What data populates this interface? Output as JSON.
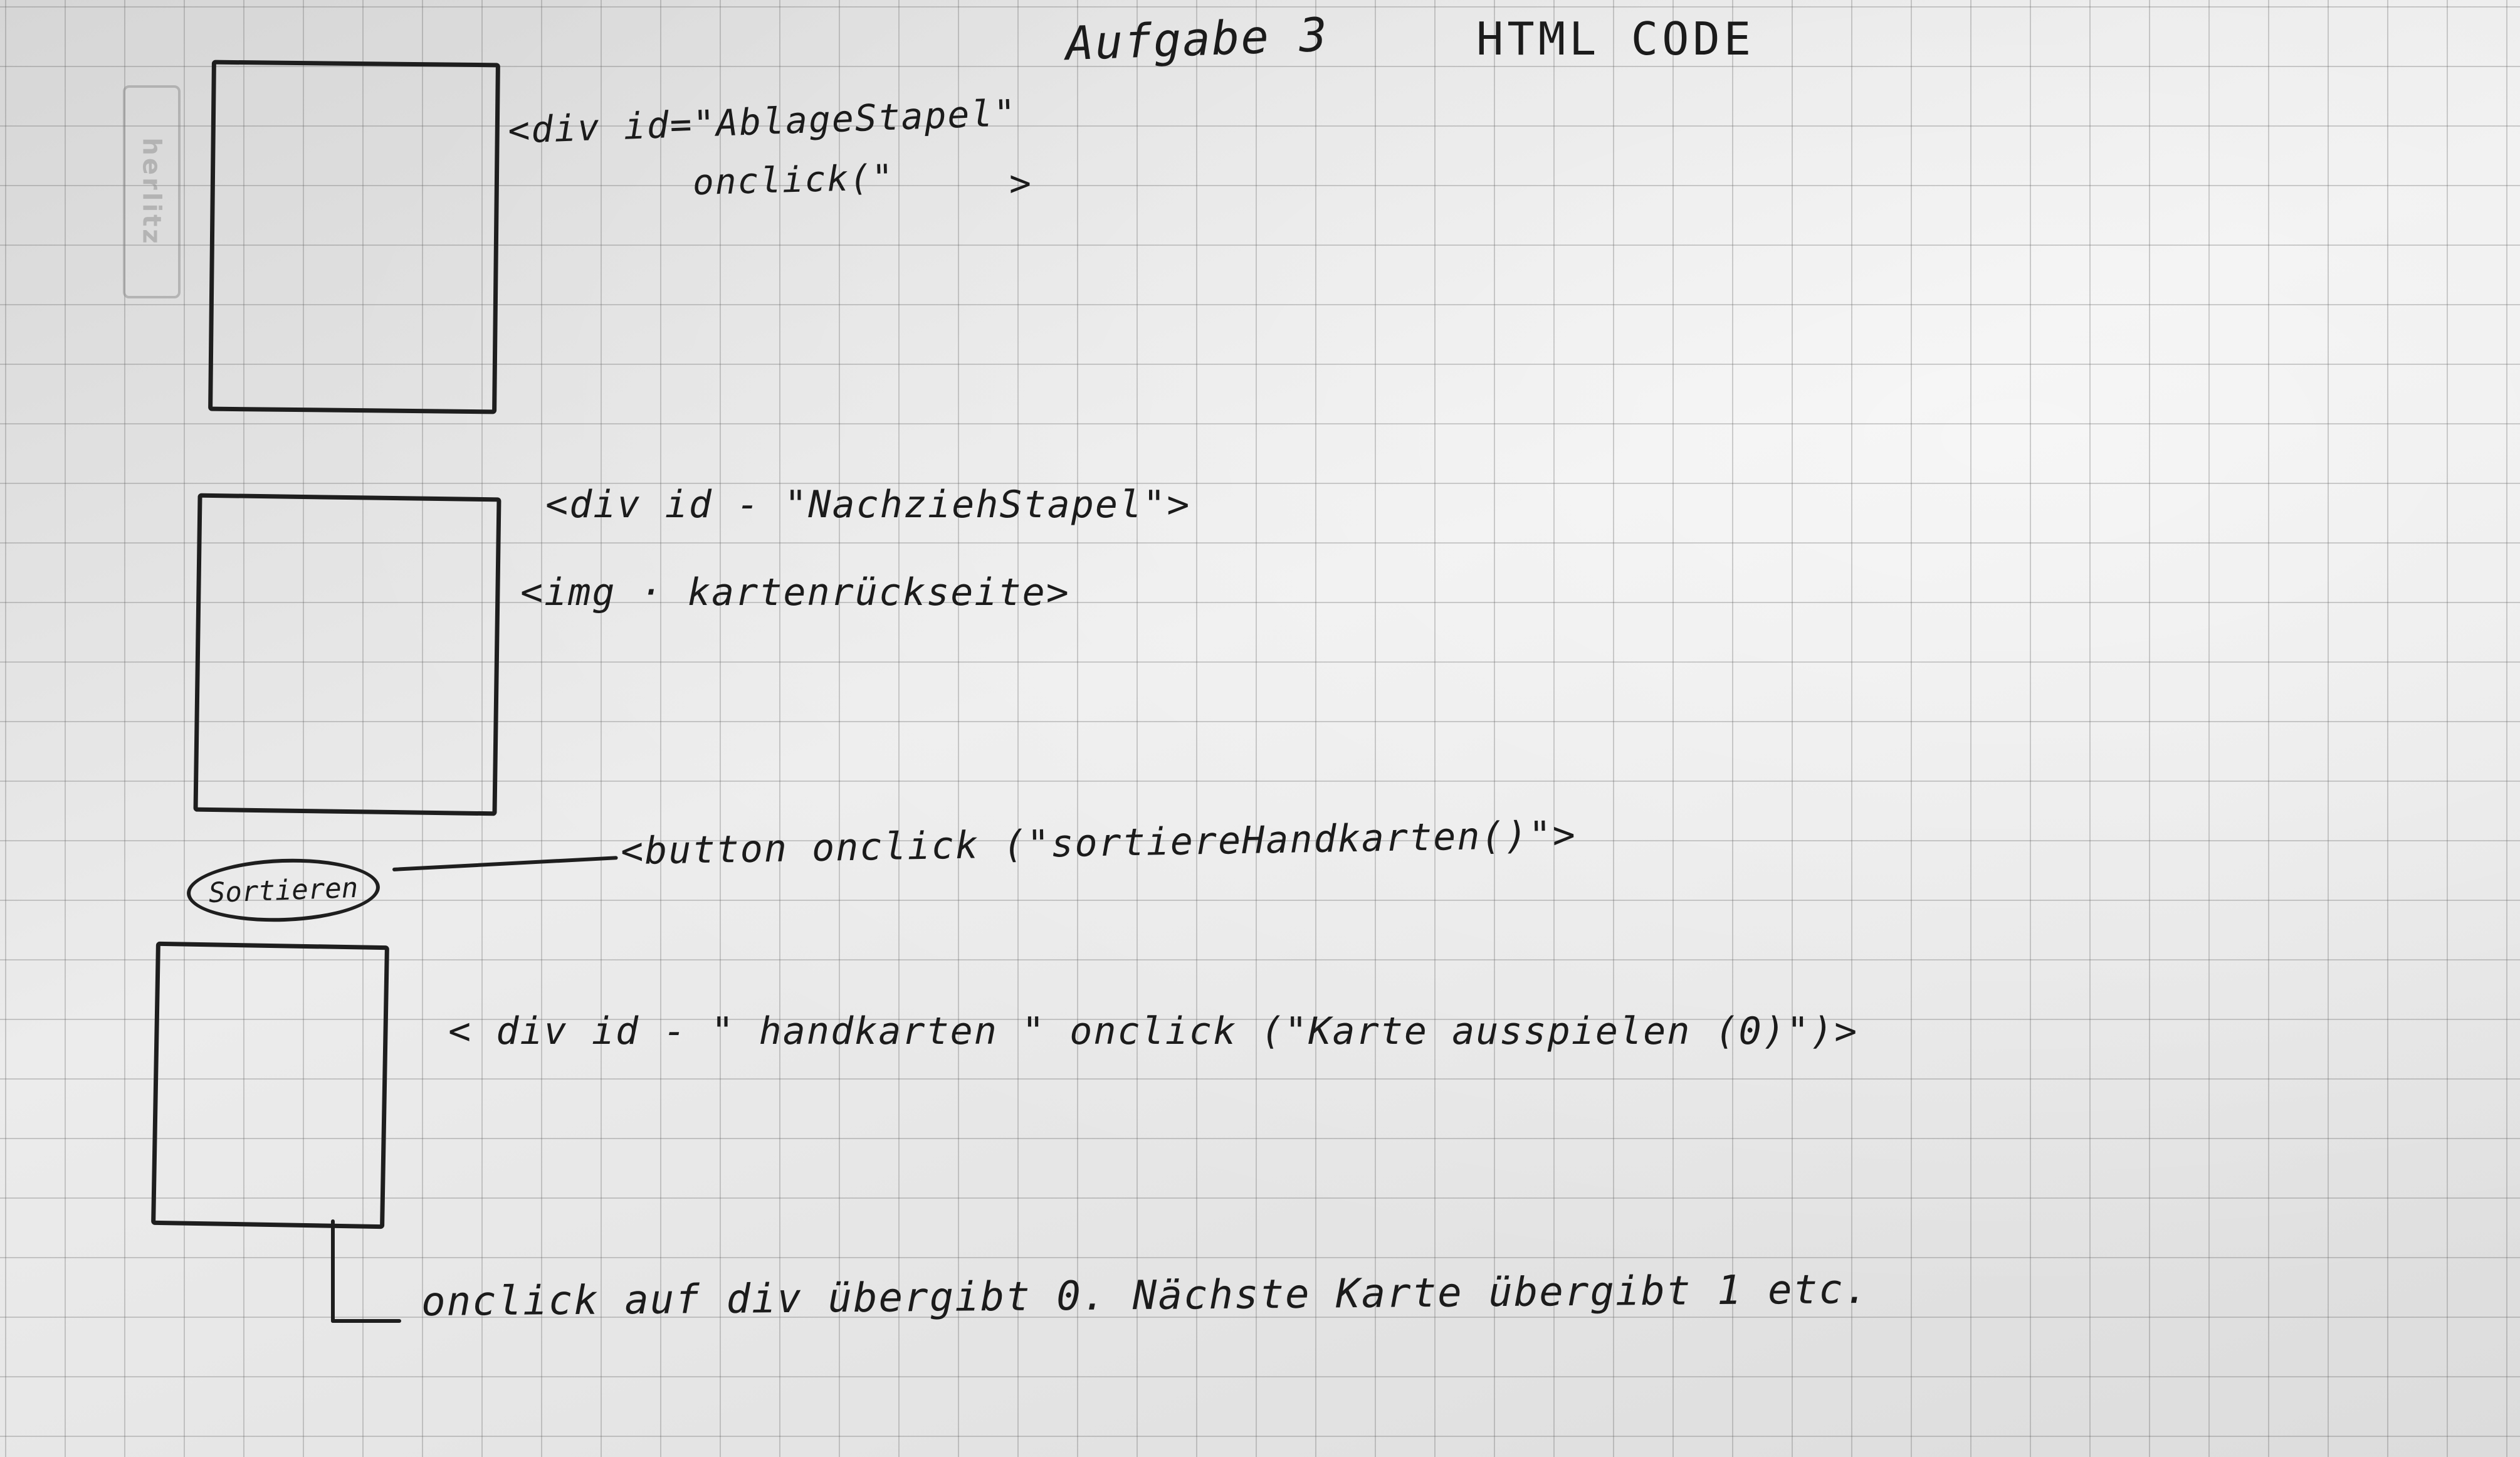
{
  "header": {
    "title": "Aufgabe 3",
    "subtitle": "HTML CODE"
  },
  "notes": {
    "ablage_line1": "<div id=\"AblageStapel\"",
    "ablage_line2": "onclick(\"",
    "ablage_close": ">",
    "nachzieh_line": "<div id - \"NachziehStapel\">",
    "img_line": "<img · kartenrückseite>",
    "button_line": "<button onclick (\"sortiereHandkarten()\">",
    "handkarten_line": "< div id - \" handkarten \" onclick (\"Karte ausspielen (0)\")>",
    "footer_line": "onclick auf div übergibt 0. Nächste Karte übergibt 1 etc."
  },
  "sortieren_button": {
    "label": "Sortieren"
  },
  "stamp": {
    "text": "herlitz"
  },
  "colors": {
    "ink": "#1e1e1e",
    "paper": "#e7e7e7",
    "grid": "#8a8a8a"
  }
}
